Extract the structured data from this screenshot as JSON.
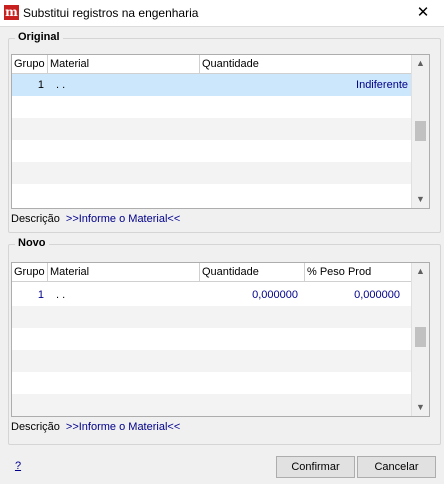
{
  "window": {
    "title": "Substitui registros na engenharia",
    "close_label": "✕"
  },
  "original": {
    "legend": "Original",
    "columns": [
      "Grupo",
      "Material",
      "Quantidade"
    ],
    "row": {
      "grupo": "1",
      "material": ". .",
      "quantidade": "Indiferente"
    },
    "desc_label": "Descrição",
    "desc_value": ">>Informe o Material<<"
  },
  "novo": {
    "legend": "Novo",
    "columns": [
      "Grupo",
      "Material",
      "Quantidade",
      "% Peso Prod"
    ],
    "row": {
      "grupo": "1",
      "material": ". .",
      "quantidade": "0,000000",
      "peso": "0,000000"
    },
    "desc_label": "Descrição",
    "desc_value": ">>Informe o Material<<"
  },
  "footer": {
    "help_label": "?",
    "confirm_label": "Confirmar",
    "cancel_label": "Cancelar"
  },
  "colors": {
    "selection": "#cce6fb",
    "value_text": "#00008b",
    "app_icon": "#c8201e"
  }
}
